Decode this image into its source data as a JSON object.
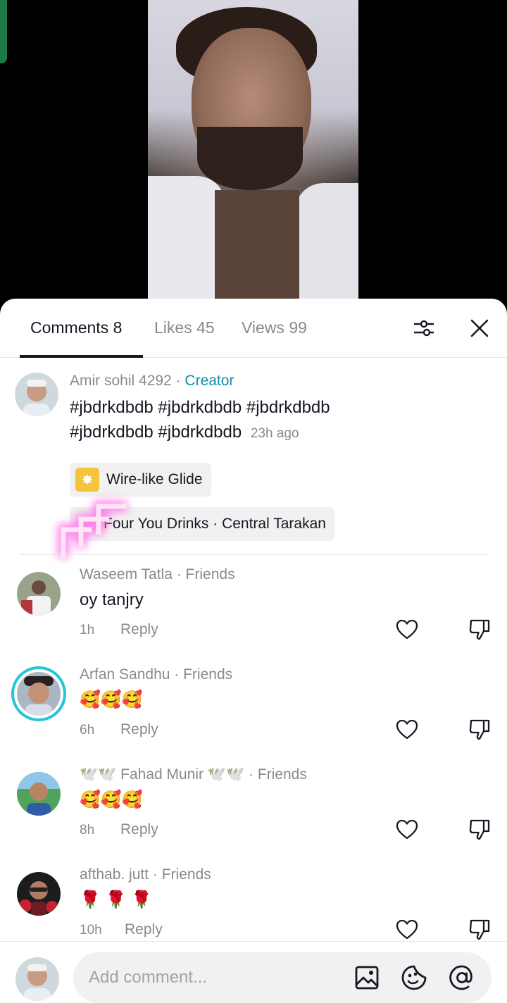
{
  "tabs": {
    "comments": "Comments 8",
    "likes": "Likes 45",
    "views": "Views 99"
  },
  "icons": {
    "filter": "filter-sliders-icon",
    "close": "close-icon",
    "like": "heart-icon",
    "dislike": "thumbs-down-icon",
    "image": "image-icon",
    "emoji": "emoji-sticker-icon",
    "mention": "at-icon"
  },
  "creator_comment": {
    "author": "Amir sohil 4292",
    "separator": " · ",
    "badge": "Creator",
    "line1": "#jbdrkdbdb #jbdrkdbdb #jbdrkdbdb",
    "line2": "#jbdrkdbdb #jbdrkdbdb",
    "time": "23h ago",
    "effect_chip": "Wire-like Glide",
    "music_chip": "Four You Drinks · Central Tarakan"
  },
  "comments": [
    {
      "author": "Waseem Tatla",
      "relation": " · Friends",
      "text": "oy tanjry",
      "time": "1h",
      "reply": "Reply"
    },
    {
      "author": "Arfan Sandhu",
      "relation": " · Friends",
      "text": "🥰🥰🥰",
      "time": "6h",
      "reply": "Reply"
    },
    {
      "author": "🕊️🕊️ Fahad Munir 🕊️🕊️",
      "relation": " · Friends",
      "text": "🥰🥰🥰",
      "time": "8h",
      "reply": "Reply"
    },
    {
      "author": "afthab. jutt",
      "relation": " · Friends",
      "text": "🌹 🌹 🌹",
      "time": "10h",
      "reply": "Reply"
    }
  ],
  "composer": {
    "placeholder": "Add comment..."
  },
  "colors": {
    "creator_badge": "#0f8fa3",
    "story_ring": "#26c4d6",
    "text_primary": "#161823",
    "text_secondary": "#8a8a8a"
  }
}
